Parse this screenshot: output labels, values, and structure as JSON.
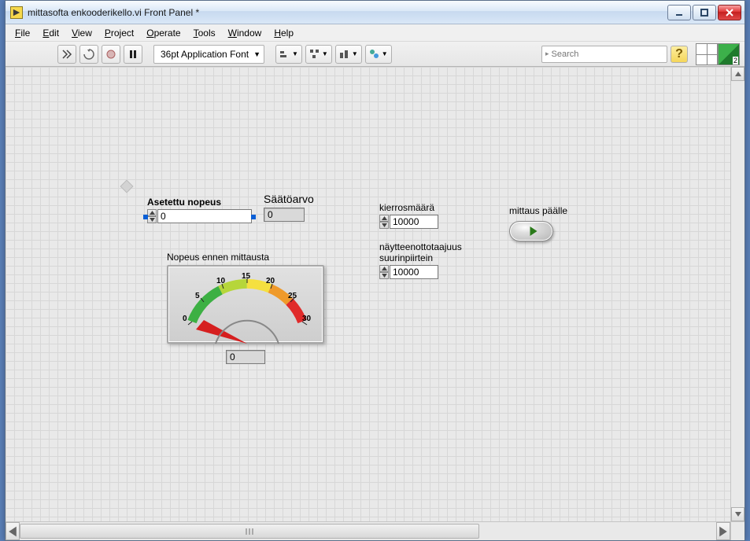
{
  "window": {
    "title": "mittasofta enkooderikello.vi Front Panel *"
  },
  "menu": {
    "file": "File",
    "edit": "Edit",
    "view": "View",
    "project": "Project",
    "operate": "Operate",
    "tools": "Tools",
    "window": "Window",
    "help": "Help"
  },
  "toolbar": {
    "font_label": "36pt Application Font",
    "search_placeholder": "Search",
    "help_label": "?"
  },
  "palette": {
    "icon_badge": "2"
  },
  "controls": {
    "asetettu_nopeus": {
      "label": "Asetettu nopeus",
      "value": "0"
    },
    "saatoarvo": {
      "label": "Säätöarvo",
      "value": "0"
    },
    "kierrosmaara": {
      "label": "kierrosmäärä",
      "value": "10000"
    },
    "naytteenotto": {
      "label1": "näytteenottotaajuus",
      "label2": "suurinpiirtein",
      "value": "10000"
    },
    "mittaus": {
      "label": "mittaus päälle"
    },
    "meter": {
      "label": "Nopeus ennen mittausta",
      "ticks": {
        "t0": "0",
        "t5": "5",
        "t10": "10",
        "t15": "15",
        "t20": "20",
        "t25": "25",
        "t30": "30"
      },
      "digital_value": "0"
    }
  }
}
